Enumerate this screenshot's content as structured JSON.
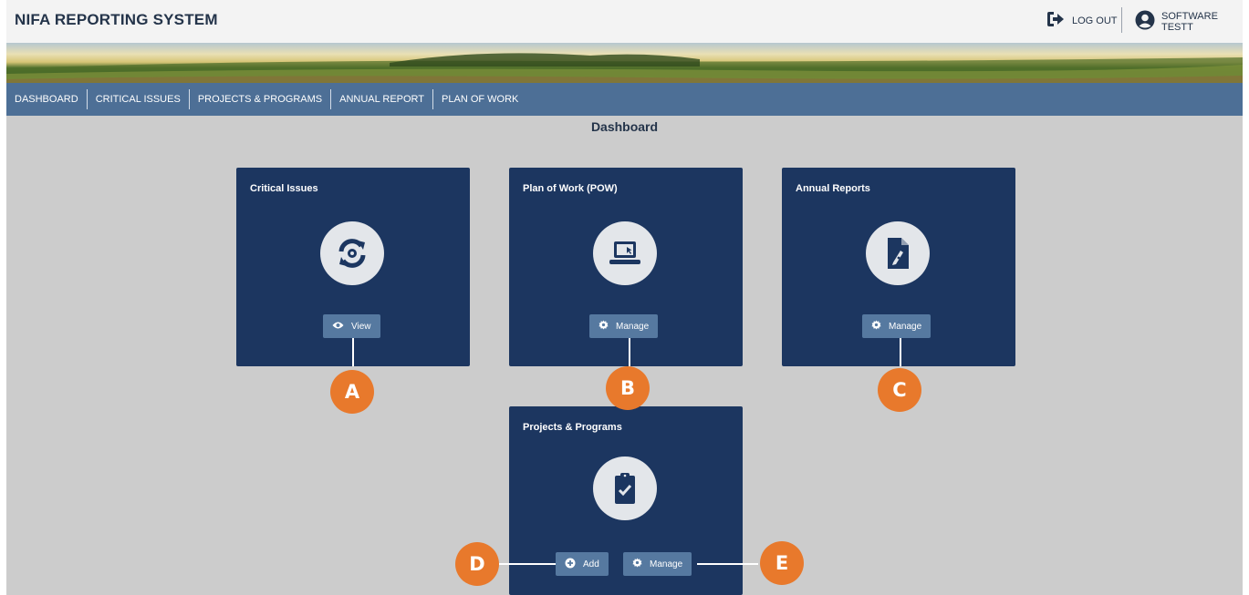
{
  "app": {
    "title": "NIFA REPORTING SYSTEM"
  },
  "header": {
    "logout_label": "LOG OUT",
    "user_label": "SOFTWARE TESTT"
  },
  "nav": {
    "items": [
      "DASHBOARD",
      "CRITICAL ISSUES",
      "PROJECTS & PROGRAMS",
      "ANNUAL REPORT",
      "PLAN OF WORK"
    ]
  },
  "page": {
    "title": "Dashboard"
  },
  "cards": {
    "critical": {
      "title": "Critical Issues",
      "icon": "sync-icon",
      "button": "View",
      "button_icon": "eye-icon"
    },
    "pow": {
      "title": "Plan of Work (POW)",
      "icon": "laptop-icon",
      "button": "Manage",
      "button_icon": "gear-icon"
    },
    "annual": {
      "title": "Annual Reports",
      "icon": "file-signature-icon",
      "button": "Manage",
      "button_icon": "gear-icon"
    },
    "projects": {
      "title": "Projects & Programs",
      "icon": "clipboard-check-icon",
      "add_button": "Add",
      "add_icon": "plus-circle-icon",
      "manage_button": "Manage",
      "manage_icon": "gear-icon"
    }
  },
  "markers": [
    "A",
    "B",
    "C",
    "D",
    "E"
  ],
  "colors": {
    "card_bg": "#1c3660",
    "button_bg": "#5679a0",
    "nav_bg": "#4d6f96",
    "marker": "#e8792c",
    "content_bg": "#cccccc"
  }
}
